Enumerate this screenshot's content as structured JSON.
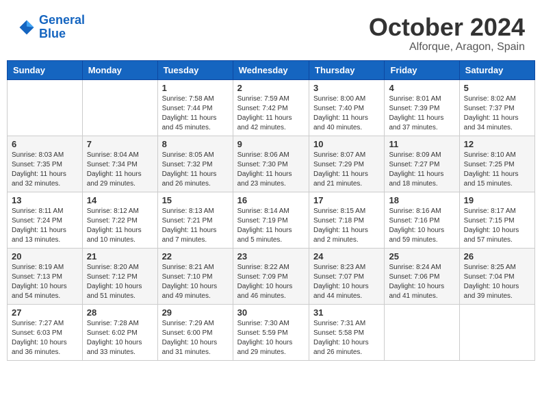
{
  "logo": {
    "text_general": "General",
    "text_blue": "Blue"
  },
  "title": "October 2024",
  "subtitle": "Alforque, Aragon, Spain",
  "days_of_week": [
    "Sunday",
    "Monday",
    "Tuesday",
    "Wednesday",
    "Thursday",
    "Friday",
    "Saturday"
  ],
  "weeks": [
    [
      {
        "day": "",
        "sunrise": "",
        "sunset": "",
        "daylight": ""
      },
      {
        "day": "",
        "sunrise": "",
        "sunset": "",
        "daylight": ""
      },
      {
        "day": "1",
        "sunrise": "Sunrise: 7:58 AM",
        "sunset": "Sunset: 7:44 PM",
        "daylight": "Daylight: 11 hours and 45 minutes."
      },
      {
        "day": "2",
        "sunrise": "Sunrise: 7:59 AM",
        "sunset": "Sunset: 7:42 PM",
        "daylight": "Daylight: 11 hours and 42 minutes."
      },
      {
        "day": "3",
        "sunrise": "Sunrise: 8:00 AM",
        "sunset": "Sunset: 7:40 PM",
        "daylight": "Daylight: 11 hours and 40 minutes."
      },
      {
        "day": "4",
        "sunrise": "Sunrise: 8:01 AM",
        "sunset": "Sunset: 7:39 PM",
        "daylight": "Daylight: 11 hours and 37 minutes."
      },
      {
        "day": "5",
        "sunrise": "Sunrise: 8:02 AM",
        "sunset": "Sunset: 7:37 PM",
        "daylight": "Daylight: 11 hours and 34 minutes."
      }
    ],
    [
      {
        "day": "6",
        "sunrise": "Sunrise: 8:03 AM",
        "sunset": "Sunset: 7:35 PM",
        "daylight": "Daylight: 11 hours and 32 minutes."
      },
      {
        "day": "7",
        "sunrise": "Sunrise: 8:04 AM",
        "sunset": "Sunset: 7:34 PM",
        "daylight": "Daylight: 11 hours and 29 minutes."
      },
      {
        "day": "8",
        "sunrise": "Sunrise: 8:05 AM",
        "sunset": "Sunset: 7:32 PM",
        "daylight": "Daylight: 11 hours and 26 minutes."
      },
      {
        "day": "9",
        "sunrise": "Sunrise: 8:06 AM",
        "sunset": "Sunset: 7:30 PM",
        "daylight": "Daylight: 11 hours and 23 minutes."
      },
      {
        "day": "10",
        "sunrise": "Sunrise: 8:07 AM",
        "sunset": "Sunset: 7:29 PM",
        "daylight": "Daylight: 11 hours and 21 minutes."
      },
      {
        "day": "11",
        "sunrise": "Sunrise: 8:09 AM",
        "sunset": "Sunset: 7:27 PM",
        "daylight": "Daylight: 11 hours and 18 minutes."
      },
      {
        "day": "12",
        "sunrise": "Sunrise: 8:10 AM",
        "sunset": "Sunset: 7:25 PM",
        "daylight": "Daylight: 11 hours and 15 minutes."
      }
    ],
    [
      {
        "day": "13",
        "sunrise": "Sunrise: 8:11 AM",
        "sunset": "Sunset: 7:24 PM",
        "daylight": "Daylight: 11 hours and 13 minutes."
      },
      {
        "day": "14",
        "sunrise": "Sunrise: 8:12 AM",
        "sunset": "Sunset: 7:22 PM",
        "daylight": "Daylight: 11 hours and 10 minutes."
      },
      {
        "day": "15",
        "sunrise": "Sunrise: 8:13 AM",
        "sunset": "Sunset: 7:21 PM",
        "daylight": "Daylight: 11 hours and 7 minutes."
      },
      {
        "day": "16",
        "sunrise": "Sunrise: 8:14 AM",
        "sunset": "Sunset: 7:19 PM",
        "daylight": "Daylight: 11 hours and 5 minutes."
      },
      {
        "day": "17",
        "sunrise": "Sunrise: 8:15 AM",
        "sunset": "Sunset: 7:18 PM",
        "daylight": "Daylight: 11 hours and 2 minutes."
      },
      {
        "day": "18",
        "sunrise": "Sunrise: 8:16 AM",
        "sunset": "Sunset: 7:16 PM",
        "daylight": "Daylight: 10 hours and 59 minutes."
      },
      {
        "day": "19",
        "sunrise": "Sunrise: 8:17 AM",
        "sunset": "Sunset: 7:15 PM",
        "daylight": "Daylight: 10 hours and 57 minutes."
      }
    ],
    [
      {
        "day": "20",
        "sunrise": "Sunrise: 8:19 AM",
        "sunset": "Sunset: 7:13 PM",
        "daylight": "Daylight: 10 hours and 54 minutes."
      },
      {
        "day": "21",
        "sunrise": "Sunrise: 8:20 AM",
        "sunset": "Sunset: 7:12 PM",
        "daylight": "Daylight: 10 hours and 51 minutes."
      },
      {
        "day": "22",
        "sunrise": "Sunrise: 8:21 AM",
        "sunset": "Sunset: 7:10 PM",
        "daylight": "Daylight: 10 hours and 49 minutes."
      },
      {
        "day": "23",
        "sunrise": "Sunrise: 8:22 AM",
        "sunset": "Sunset: 7:09 PM",
        "daylight": "Daylight: 10 hours and 46 minutes."
      },
      {
        "day": "24",
        "sunrise": "Sunrise: 8:23 AM",
        "sunset": "Sunset: 7:07 PM",
        "daylight": "Daylight: 10 hours and 44 minutes."
      },
      {
        "day": "25",
        "sunrise": "Sunrise: 8:24 AM",
        "sunset": "Sunset: 7:06 PM",
        "daylight": "Daylight: 10 hours and 41 minutes."
      },
      {
        "day": "26",
        "sunrise": "Sunrise: 8:25 AM",
        "sunset": "Sunset: 7:04 PM",
        "daylight": "Daylight: 10 hours and 39 minutes."
      }
    ],
    [
      {
        "day": "27",
        "sunrise": "Sunrise: 7:27 AM",
        "sunset": "Sunset: 6:03 PM",
        "daylight": "Daylight: 10 hours and 36 minutes."
      },
      {
        "day": "28",
        "sunrise": "Sunrise: 7:28 AM",
        "sunset": "Sunset: 6:02 PM",
        "daylight": "Daylight: 10 hours and 33 minutes."
      },
      {
        "day": "29",
        "sunrise": "Sunrise: 7:29 AM",
        "sunset": "Sunset: 6:00 PM",
        "daylight": "Daylight: 10 hours and 31 minutes."
      },
      {
        "day": "30",
        "sunrise": "Sunrise: 7:30 AM",
        "sunset": "Sunset: 5:59 PM",
        "daylight": "Daylight: 10 hours and 29 minutes."
      },
      {
        "day": "31",
        "sunrise": "Sunrise: 7:31 AM",
        "sunset": "Sunset: 5:58 PM",
        "daylight": "Daylight: 10 hours and 26 minutes."
      },
      {
        "day": "",
        "sunrise": "",
        "sunset": "",
        "daylight": ""
      },
      {
        "day": "",
        "sunrise": "",
        "sunset": "",
        "daylight": ""
      }
    ]
  ]
}
